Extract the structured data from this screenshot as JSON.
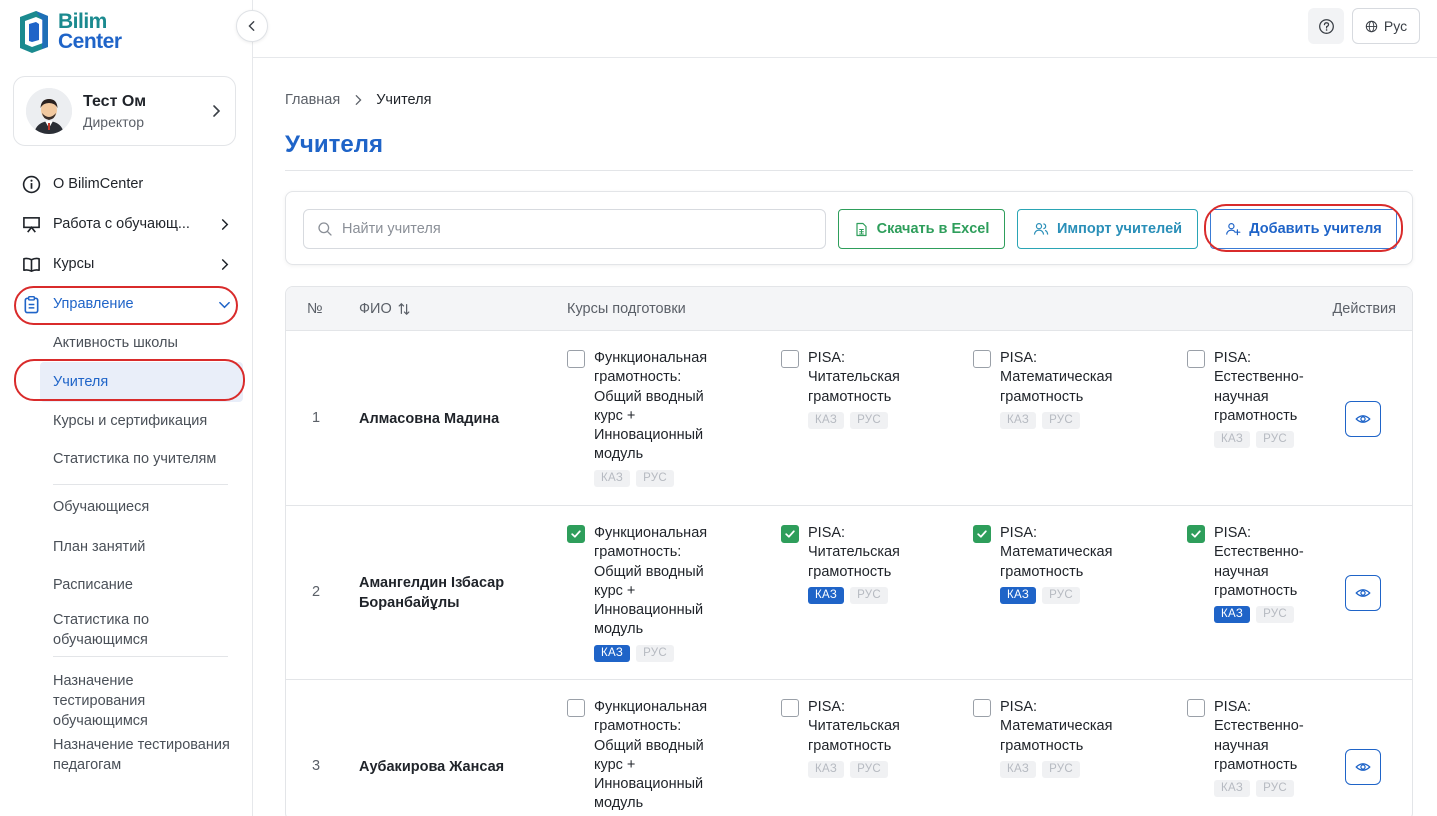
{
  "logo": {
    "line1": "Bilim",
    "line2": "Center"
  },
  "profile": {
    "name": "Тест Ом",
    "role": "Директор"
  },
  "nav": {
    "about": "О BilimCenter",
    "students_work": "Работа с обучающ...",
    "courses": "Курсы",
    "management": "Управление",
    "sub": {
      "school_activity": "Активность школы",
      "teachers": "Учителя",
      "courses_cert": "Курсы и сертификация",
      "teacher_stats": "Статистика по учителям",
      "students": "Обучающиеся",
      "lesson_plan": "План занятий",
      "schedule": "Расписание",
      "student_stats": "Статистика по обучающимся",
      "assign_students": "Назначение тестирования обучающимся",
      "assign_teachers": "Назначение тестирования педагогам"
    }
  },
  "header": {
    "lang": "Рус"
  },
  "breadcrumb": {
    "home": "Главная",
    "current": "Учителя"
  },
  "page": {
    "title": "Учителя"
  },
  "toolbar": {
    "search_placeholder": "Найти учителя",
    "excel": "Скачать в Excel",
    "import": "Импорт учителей",
    "add": "Добавить учителя"
  },
  "table": {
    "headers": {
      "num": "№",
      "fio": "ФИО",
      "courses": "Курсы подготовки",
      "actions": "Действия"
    },
    "course_titles": [
      "Функциональная грамотность: Общий вводный курс + Инновационный модуль",
      "PISA: Читательская грамотность",
      "PISA: Математическая грамотность",
      "PISA: Естественно-научная грамотность"
    ],
    "course_lines": [
      [
        "Функциональная",
        "грамотность:",
        "Общий вводный",
        "курс +",
        "Инновационный",
        "модуль"
      ],
      [
        "PISA:",
        "Читательская",
        "грамотность"
      ],
      [
        "PISA:",
        "Математическая",
        "грамотность"
      ],
      [
        "PISA:",
        "Естественно-",
        "научная",
        "грамотность"
      ]
    ],
    "tag_kaz": "КАЗ",
    "tag_rus": "РУС",
    "rows": [
      {
        "num": "1",
        "fio": "Алмасовна Мадина",
        "checked": [
          false,
          false,
          false,
          false
        ],
        "kaz": [
          false,
          false,
          false,
          false
        ],
        "rus": [
          false,
          false,
          false,
          false
        ]
      },
      {
        "num": "2",
        "fio": "Амангелдин Ізбасар Боранбайұлы",
        "checked": [
          true,
          true,
          true,
          true
        ],
        "kaz": [
          true,
          true,
          true,
          true
        ],
        "rus": [
          false,
          false,
          false,
          false
        ]
      },
      {
        "num": "3",
        "fio": "Аубакирова Жансая",
        "checked": [
          false,
          false,
          false,
          false
        ],
        "kaz": [
          false,
          false,
          false,
          false
        ],
        "rus": [
          false,
          false,
          false,
          false
        ]
      }
    ]
  },
  "colors": {
    "primary": "#1f64c8",
    "success": "#2e9e5b",
    "highlight_ring": "#d92b2b"
  }
}
